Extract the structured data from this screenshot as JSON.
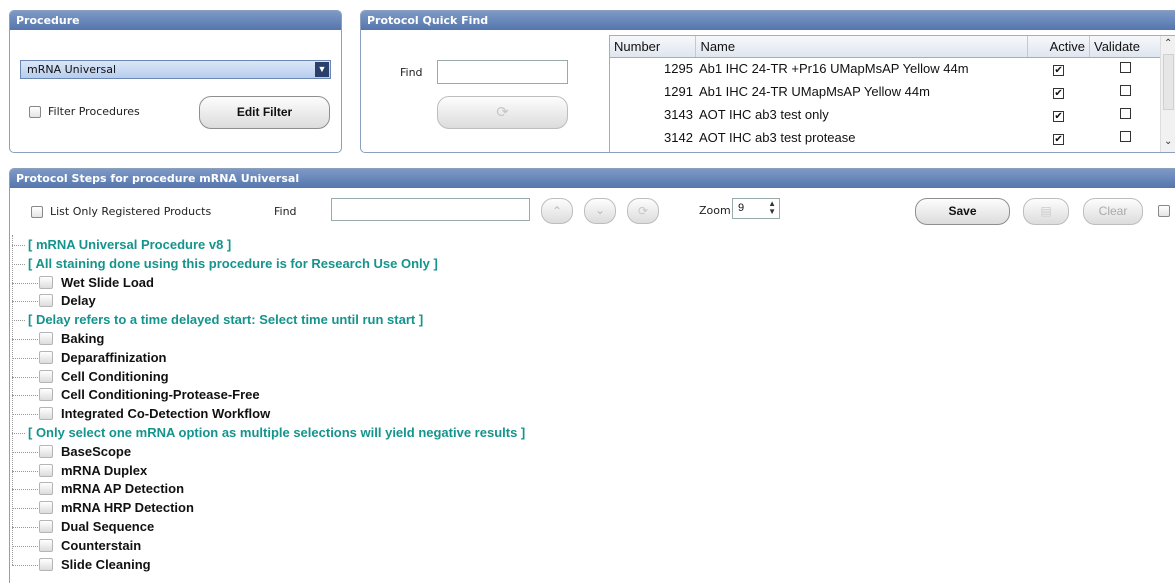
{
  "procedure": {
    "title": "Procedure",
    "selected": "mRNA Universal",
    "filter_label": "Filter Procedures",
    "edit_filter": "Edit Filter"
  },
  "quickfind": {
    "title": "Protocol Quick Find",
    "find_label": "Find",
    "find_value": "",
    "columns": [
      "Number",
      "Name",
      "Active",
      "Validate"
    ],
    "rows": [
      {
        "number": "1295",
        "name": "Ab1 IHC 24-TR +Pr16 UMapMsAP Yellow 44m",
        "active": true,
        "validate": false
      },
      {
        "number": "1291",
        "name": "Ab1 IHC 24-TR UMapMsAP Yellow 44m",
        "active": true,
        "validate": false
      },
      {
        "number": "3143",
        "name": "AOT IHC ab3 test only",
        "active": true,
        "validate": false
      },
      {
        "number": "3142",
        "name": "AOT IHC ab3 test protease",
        "active": true,
        "validate": false
      }
    ]
  },
  "steps": {
    "title": "Protocol Steps for procedure mRNA Universal",
    "list_only_label": "List Only Registered Products",
    "find_label": "Find",
    "find_value": "",
    "zoom_label": "Zoom",
    "zoom_value": "9",
    "save": "Save",
    "clear": "Clear",
    "nodes": [
      {
        "kind": "note",
        "text": "[ mRNA Universal Procedure v8 ]"
      },
      {
        "kind": "note",
        "text": "[ All staining done using this procedure is for Research Use Only ]"
      },
      {
        "kind": "step",
        "text": "Wet Slide Load"
      },
      {
        "kind": "step",
        "text": "Delay"
      },
      {
        "kind": "note",
        "text": "[ Delay refers to a time delayed start: Select time until run start ]"
      },
      {
        "kind": "step",
        "text": "Baking"
      },
      {
        "kind": "step",
        "text": "Deparaffinization"
      },
      {
        "kind": "step",
        "text": "Cell Conditioning"
      },
      {
        "kind": "step",
        "text": "Cell Conditioning-Protease-Free"
      },
      {
        "kind": "step",
        "text": "Integrated Co-Detection Workflow"
      },
      {
        "kind": "note",
        "text": "[ Only select one mRNA option as multiple selections will yield negative results ]"
      },
      {
        "kind": "step",
        "text": "BaseScope"
      },
      {
        "kind": "step",
        "text": "mRNA Duplex"
      },
      {
        "kind": "step",
        "text": "mRNA AP Detection"
      },
      {
        "kind": "step",
        "text": "mRNA HRP Detection"
      },
      {
        "kind": "step",
        "text": "Dual Sequence"
      },
      {
        "kind": "step",
        "text": "Counterstain"
      },
      {
        "kind": "step",
        "text": "Slide Cleaning"
      }
    ]
  }
}
